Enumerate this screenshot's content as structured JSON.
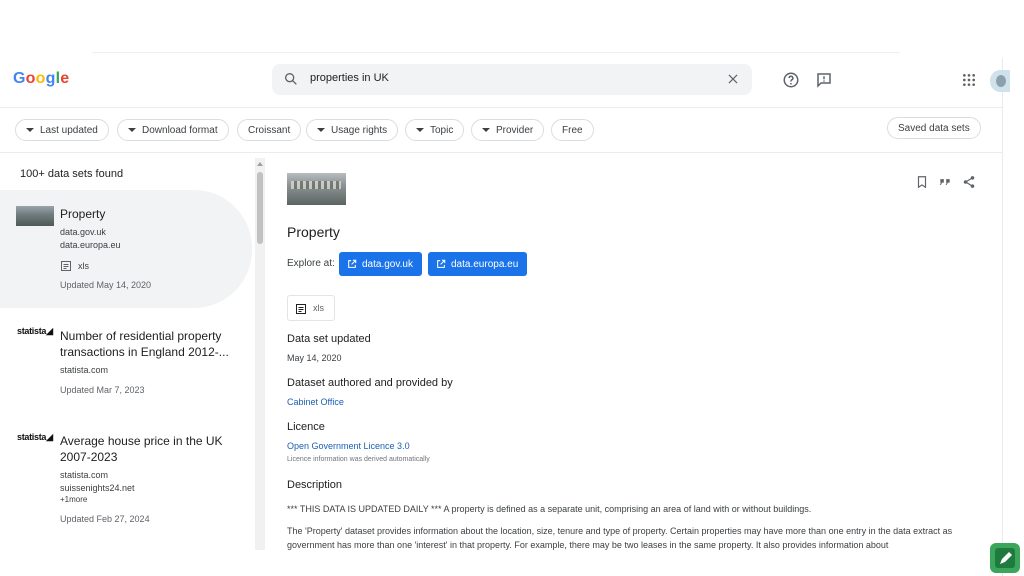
{
  "header": {
    "logo": {
      "g1": "G",
      "o1": "o",
      "o2": "o",
      "g2": "g",
      "l": "l",
      "e": "e"
    },
    "search_value": "properties in UK",
    "icons": [
      "search-icon",
      "close-icon",
      "help-icon",
      "feedback-icon",
      "apps-grid-icon"
    ]
  },
  "filters": {
    "last_updated": "Last updated",
    "download_format": "Download format",
    "croissant": "Croissant",
    "usage_rights": "Usage rights",
    "topic": "Topic",
    "provider": "Provider",
    "free": "Free",
    "saved": "Saved data sets"
  },
  "results": {
    "count": "100+ data sets found",
    "items": [
      {
        "title": "Property",
        "sources": [
          "data.gov.uk",
          "data.europa.eu"
        ],
        "format": "xls",
        "updated": "Updated May 14, 2020"
      },
      {
        "brand": "statista",
        "title": "Number of residential property transactions in England 2012-...",
        "sources": [
          "statista.com"
        ],
        "updated": "Updated Mar 7, 2023"
      },
      {
        "brand": "statista",
        "title": "Average house price in the UK 2007-2023",
        "sources": [
          "statista.com",
          "suissenights24.net"
        ],
        "more": "+1more",
        "updated": "Updated Feb 27, 2024"
      }
    ]
  },
  "detail": {
    "title": "Property",
    "explore_label": "Explore at:",
    "explore_links": [
      "data.gov.uk",
      "data.europa.eu"
    ],
    "format": "xls",
    "updated_heading": "Data set updated",
    "updated_value": "May 14, 2020",
    "author_heading": "Dataset authored and provided by",
    "author_value": "Cabinet Office",
    "licence_heading": "Licence",
    "licence_value": "Open Government Licence 3.0",
    "licence_note": "Licence information was derived automatically",
    "description_heading": "Description",
    "description_p1": "*** THIS DATA IS UPDATED DAILY *** A property is defined as a separate unit, comprising an area of land with or without buildings.",
    "description_p2": "The 'Property' dataset provides information about the location, size, tenure and type of property. Certain properties may have more than one entry in the data extract as government has more than one 'interest' in that property. For example, there may be two leases in the same property. It also provides information about"
  },
  "colors": {
    "accent": "#1a73e8",
    "selected_bg": "#f1f3f4",
    "link": "#1a5fb4"
  }
}
